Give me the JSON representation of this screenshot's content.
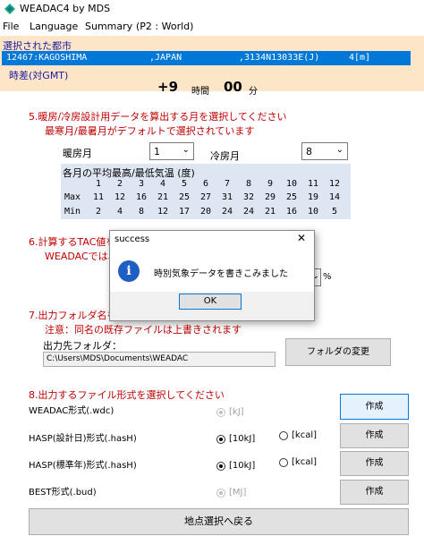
{
  "window": {
    "title": "WEADAC4   by MDS"
  },
  "menu": {
    "items": [
      "File",
      "Language",
      "Summary",
      "(P2 : World)"
    ]
  },
  "location": {
    "selected_label": "選択された都市",
    "code_name": "12467:KAGOSHIMA",
    "country": ",JAPAN",
    "coords": ",3134N13033E(J)",
    "elevation": "4[m]",
    "tz_label": "時差(対GMT)",
    "tz_hours": "+9",
    "tz_hours_unit": "時間",
    "tz_minutes": "00",
    "tz_minutes_unit": "分"
  },
  "section5": {
    "title": "5.暖房/冷房設計用データを算出する月を選択してください",
    "note": "最寒月/最暑月がデフォルトで選択されています",
    "heating_label": "暖房月",
    "heating_value": "1",
    "cooling_label": "冷房月",
    "cooling_value": "8"
  },
  "monthly_temps": {
    "title": "各月の平均最高/最低気温 (度)",
    "months": [
      "1",
      "2",
      "3",
      "4",
      "5",
      "6",
      "7",
      "8",
      "9",
      "10",
      "11",
      "12"
    ],
    "max_label": "Max",
    "max": [
      "11",
      "12",
      "16",
      "21",
      "25",
      "27",
      "31",
      "32",
      "29",
      "25",
      "19",
      "14"
    ],
    "min_label": "Min",
    "min": [
      "2",
      "4",
      "8",
      "12",
      "17",
      "20",
      "24",
      "24",
      "21",
      "16",
      "10",
      "5"
    ]
  },
  "section6": {
    "title": "6.計算するTAC値を",
    "note": "WEADACでは、",
    "unit": "%"
  },
  "section7": {
    "title": "7.出力フォルダ名を",
    "note": "注意：同名の既存ファイルは上書きされます",
    "folder_label": "出力先フォルダ：",
    "folder_path": "C:\\Users\\MDS\\Documents\\WEADAC",
    "change_button": "フォルダの変更"
  },
  "section8": {
    "title": "8.出力するファイル形式を選択してください",
    "rows": [
      {
        "label": "WEADAC形式(.wdc)",
        "opt1": "[kJ]",
        "opt2": "",
        "button": "作成"
      },
      {
        "label": "HASP(設計日)形式(.hasH)",
        "opt1": "[10kJ]",
        "opt2": "[kcal]",
        "button": "作成"
      },
      {
        "label": "HASP(標準年)形式(.hasH)",
        "opt1": "[10kJ]",
        "opt2": "[kcal]",
        "button": "作成"
      },
      {
        "label": "BEST形式(.bud)",
        "opt1": "[MJ]",
        "opt2": "",
        "button": "作成"
      }
    ],
    "back_button": "地点選択へ戻る"
  },
  "dialog": {
    "title": "success",
    "close": "✕",
    "message": "時別気象データを書きこみました",
    "ok": "OK"
  }
}
